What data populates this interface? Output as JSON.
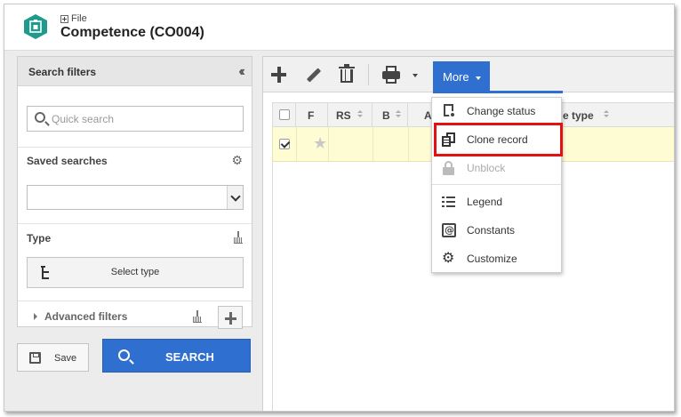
{
  "header": {
    "breadcrumb": "File",
    "title": "Competence (CO004)",
    "icon_color": "#1f9a8c"
  },
  "search_filters": {
    "title": "Search filters",
    "quick_search_placeholder": "Quick search",
    "saved_searches_label": "Saved searches",
    "saved_search_selected": "",
    "type_label": "Type",
    "select_type_label": "Select type",
    "advanced_filters_label": "Advanced filters"
  },
  "actions": {
    "save_label": "Save",
    "search_label": "SEARCH"
  },
  "toolbar": {
    "more_label": "More",
    "accent_color": "#2f6fd0"
  },
  "grid": {
    "columns": [
      "F",
      "RS",
      "B",
      "A",
      "e type"
    ],
    "rows": [
      {
        "checked": true,
        "favorite": false
      }
    ]
  },
  "more_menu": {
    "items": [
      {
        "label": "Change status",
        "icon": "change-status-icon",
        "enabled": true
      },
      {
        "label": "Clone record",
        "icon": "clone-icon",
        "enabled": true,
        "highlighted": true
      },
      {
        "label": "Unblock",
        "icon": "lock-icon",
        "enabled": false
      },
      {
        "label": "Legend",
        "icon": "legend-icon",
        "enabled": true
      },
      {
        "label": "Constants",
        "icon": "constants-icon",
        "enabled": true
      },
      {
        "label": "Customize",
        "icon": "gear-icon",
        "enabled": true
      }
    ],
    "highlight_color": "#e31212"
  }
}
